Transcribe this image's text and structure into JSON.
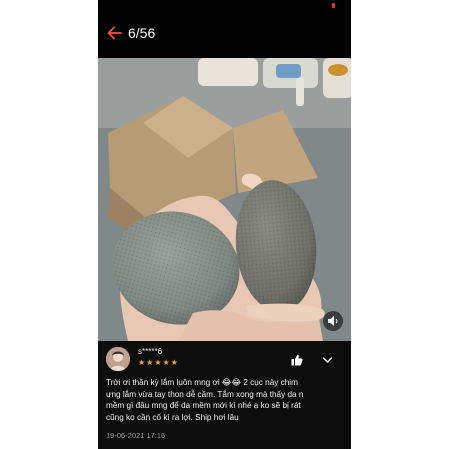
{
  "header": {
    "counter": "6/56",
    "back_icon": "arrow-left-icon",
    "accent_color": "#ff5722"
  },
  "media": {
    "description_icon": "volume-icon"
  },
  "review": {
    "username": "s*****6",
    "rating": 5,
    "stars": [
      "★",
      "★",
      "★",
      "★",
      "★"
    ],
    "text": "Trời ơi thần kỳ lắm luôn mng ơi 😂😂 2 cục này chim\nưng lắm vừa tay thon dễ cầm. Tắm xong mà thấy da n\nmềm gì đâu mng để da mềm mới kì nhé ạ ko sẽ bị rát\ncũng ko cần cố kì ra lợi. Ship hơi lâu",
    "date": "19-06-2021 17:16",
    "star_color": "#f5a623",
    "like_icon": "thumbs-up-icon",
    "expand_icon": "chevron-down-icon"
  }
}
